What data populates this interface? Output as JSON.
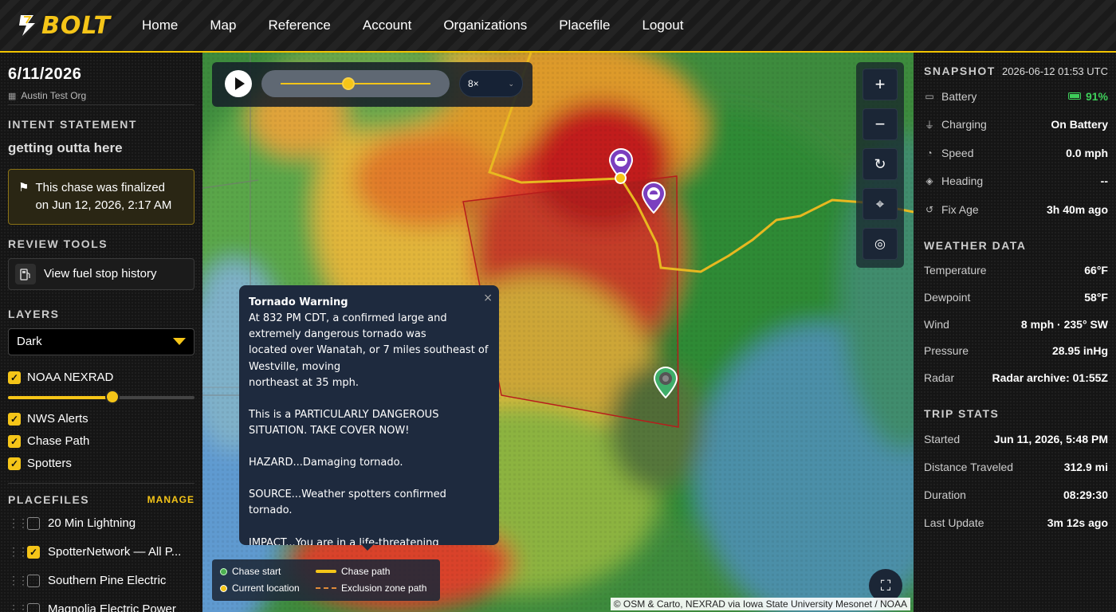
{
  "header": {
    "logo_text": "BOLT",
    "nav": [
      "Home",
      "Map",
      "Reference",
      "Account",
      "Organizations",
      "Placefile",
      "Logout"
    ]
  },
  "left": {
    "date": "6/11/2026",
    "org": "Austin Test Org",
    "intent_title": "INTENT STATEMENT",
    "intent_text": "getting outta here",
    "finalized_line1": "This chase was finalized",
    "finalized_line2": "on Jun 12, 2026, 2:17 AM",
    "review_title": "REVIEW TOOLS",
    "fuel_label": "View fuel stop history",
    "layers_title": "LAYERS",
    "basemap_value": "Dark",
    "nexrad_opacity": 0.56,
    "layers": [
      {
        "label": "NOAA NEXRAD",
        "checked": true
      },
      {
        "label": "NWS Alerts",
        "checked": true
      },
      {
        "label": "Chase Path",
        "checked": true
      },
      {
        "label": "Spotters",
        "checked": true
      }
    ],
    "placefiles_title": "PLACEFILES",
    "manage_label": "MANAGE",
    "placefiles": [
      {
        "label": "20 Min Lightning",
        "checked": false
      },
      {
        "label": "SpotterNetwork — All P...",
        "checked": true
      },
      {
        "label": "Southern Pine Electric",
        "checked": false
      },
      {
        "label": "Magnolia Electric Power",
        "checked": false
      }
    ]
  },
  "map": {
    "speed_value": "8×",
    "timeline_position": 0.45,
    "popup": {
      "title": "Tornado Warning",
      "lines": [
        "At 832 PM CDT, a confirmed large and",
        "extremely dangerous tornado was",
        "located over Wanatah, or 7 miles southeast of",
        "Westville, moving",
        "northeast at 35 mph."
      ],
      "p2": "This is a PARTICULARLY DANGEROUS SITUATION. TAKE COVER NOW!",
      "p3": "HAZARD...Damaging tornado.",
      "p4": "SOURCE...Weather spotters confirmed tornado.",
      "p5": "IMPACT...You are in a life-threatening situation.",
      "close": "×"
    },
    "legend": {
      "chase_start": "Chase start",
      "current_location": "Current location",
      "chase_path": "Chase path",
      "exclusion_path": "Exclusion zone path"
    },
    "attribution": "© OSM & Carto, NEXRAD via Iowa State University Mesonet / NOAA",
    "colors": {
      "accent": "#f5c518",
      "chase_start": "#4caf50",
      "current": "#f5c518",
      "warning_polygon": "#b71c1c",
      "spotter": "#7b3fbf"
    }
  },
  "right": {
    "snapshot_title": "SNAPSHOT",
    "snapshot_time": "2026-06-12 01:53 UTC",
    "snapshot": [
      {
        "icon": "battery-icon",
        "label": "Battery",
        "value": "91%"
      },
      {
        "icon": "plug-icon",
        "label": "Charging",
        "value": "On Battery"
      },
      {
        "icon": "speedometer-icon",
        "label": "Speed",
        "value": "0.0 mph"
      },
      {
        "icon": "compass-icon",
        "label": "Heading",
        "value": "--"
      },
      {
        "icon": "history-icon",
        "label": "Fix Age",
        "value": "3h 40m ago"
      }
    ],
    "weather_title": "WEATHER DATA",
    "weather": [
      {
        "label": "Temperature",
        "value": "66°F"
      },
      {
        "label": "Dewpoint",
        "value": "58°F"
      },
      {
        "label": "Wind",
        "value": "8 mph · 235° SW"
      },
      {
        "label": "Pressure",
        "value": "28.95 inHg"
      },
      {
        "label": "Radar",
        "value": "Radar archive: 01:55Z"
      }
    ],
    "trip_title": "TRIP STATS",
    "trip": [
      {
        "label": "Started",
        "value": "Jun 11, 2026, 5:48 PM"
      },
      {
        "label": "Distance Traveled",
        "value": "312.9 mi"
      },
      {
        "label": "Duration",
        "value": "08:29:30"
      },
      {
        "label": "Last Update",
        "value": "3m 12s ago"
      }
    ]
  }
}
